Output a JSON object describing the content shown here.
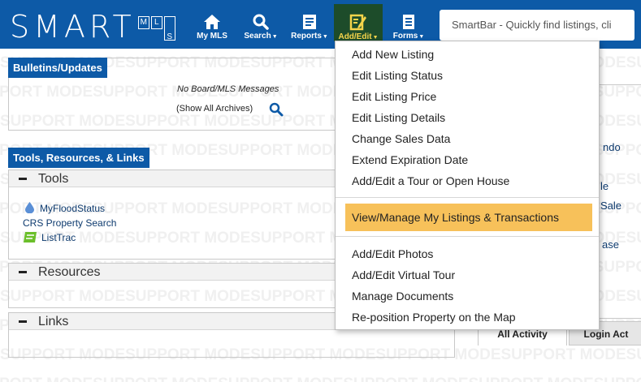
{
  "logo": {
    "text": "SMART",
    "boxes": [
      "M",
      "L",
      "S"
    ]
  },
  "nav": [
    {
      "label": "My MLS",
      "icon": "home-icon"
    },
    {
      "label": "Search",
      "icon": "search-icon"
    },
    {
      "label": "Reports",
      "icon": "report-icon"
    },
    {
      "label": "Add/Edit",
      "icon": "edit-icon"
    },
    {
      "label": "Forms",
      "icon": "document-icon"
    }
  ],
  "smartbar": {
    "placeholder": "SmartBar - Quickly find listings, cli"
  },
  "watermark": "SUPPORT MODE",
  "bulletins": {
    "title": "Bulletins/Updates",
    "message": "No Board/MLS Messages",
    "archives_link": "(Show All Archives)"
  },
  "tools_panel": {
    "title": "Tools, Resources, & Links",
    "sections": [
      "Tools",
      "Resources",
      "Links"
    ],
    "tools": [
      "MyFloodStatus",
      "CRS Property Search",
      "ListTrac"
    ]
  },
  "right_column": {
    "fragments": [
      "ndo",
      "le",
      "Sale",
      "ase"
    ],
    "tabs": [
      "All Activity",
      "Login Act"
    ]
  },
  "dropdown": {
    "group1": [
      "Add New Listing",
      "Edit Listing Status",
      "Edit Listing Price",
      "Edit Listing Details",
      "Change Sales Data",
      "Extend Expiration Date",
      "Add/Edit a Tour or Open House"
    ],
    "highlighted": "View/Manage My Listings & Transactions",
    "group3": [
      "Add/Edit Photos",
      "Add/Edit Virtual Tour",
      "Manage Documents",
      "Re-position Property on the Map"
    ]
  },
  "colors": {
    "nav_bg": "#0d5aa7",
    "active_bg": "#1d4c2a",
    "highlight": "#f7c15a",
    "link": "#0d3a6e"
  }
}
